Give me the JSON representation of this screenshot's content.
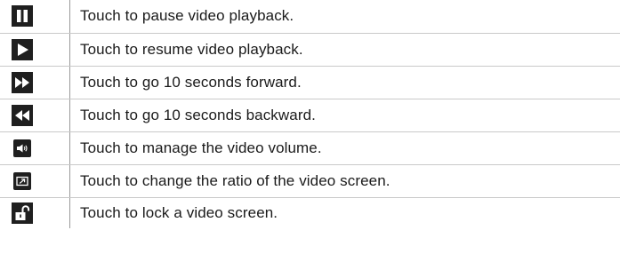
{
  "rows": [
    {
      "icon": "pause-icon",
      "description": "Touch to pause video playback."
    },
    {
      "icon": "play-icon",
      "description": "Touch to resume video playback."
    },
    {
      "icon": "fast-forward-icon",
      "description": "Touch to go 10 seconds forward."
    },
    {
      "icon": "rewind-icon",
      "description": "Touch to go 10 seconds backward."
    },
    {
      "icon": "volume-icon",
      "description": "Touch to manage the video volume."
    },
    {
      "icon": "screen-ratio-icon",
      "description": "Touch to change the ratio of the video screen."
    },
    {
      "icon": "lock-icon",
      "description": "Touch to lock a video screen."
    }
  ],
  "colors": {
    "icon_background": "#1f1f1f",
    "icon_glyph": "#ffffff",
    "text": "#1a1a1a",
    "row_divider": "#c9c9c9",
    "column_divider": "#9a9a9a"
  }
}
